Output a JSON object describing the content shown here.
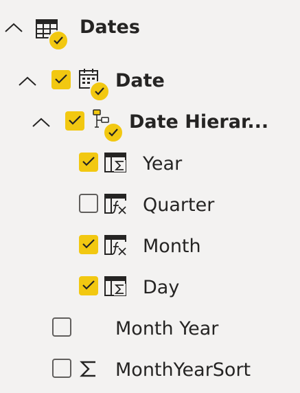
{
  "tree": {
    "table": {
      "label": "Dates",
      "expanded": true,
      "icon": "table-icon"
    },
    "date_column": {
      "label": "Date",
      "checked": true,
      "expanded": true,
      "icon": "calendar-icon"
    },
    "hierarchy": {
      "label": "Date Hierar...",
      "checked": true,
      "expanded": true,
      "icon": "hierarchy-icon"
    },
    "levels": [
      {
        "label": "Year",
        "checked": true,
        "icon": "calculated-column-icon"
      },
      {
        "label": "Quarter",
        "checked": false,
        "icon": "calculated-fx-icon"
      },
      {
        "label": "Month",
        "checked": true,
        "icon": "calculated-fx-icon"
      },
      {
        "label": "Day",
        "checked": true,
        "icon": "calculated-column-icon"
      }
    ],
    "fields": [
      {
        "label": "Month Year",
        "checked": false,
        "icon": ""
      },
      {
        "label": "MonthYearSort",
        "checked": false,
        "icon": "sigma-icon"
      }
    ]
  },
  "colors": {
    "accent": "#f2c811",
    "background": "#f3f2f1",
    "text": "#252423",
    "border": "#605e5c"
  }
}
